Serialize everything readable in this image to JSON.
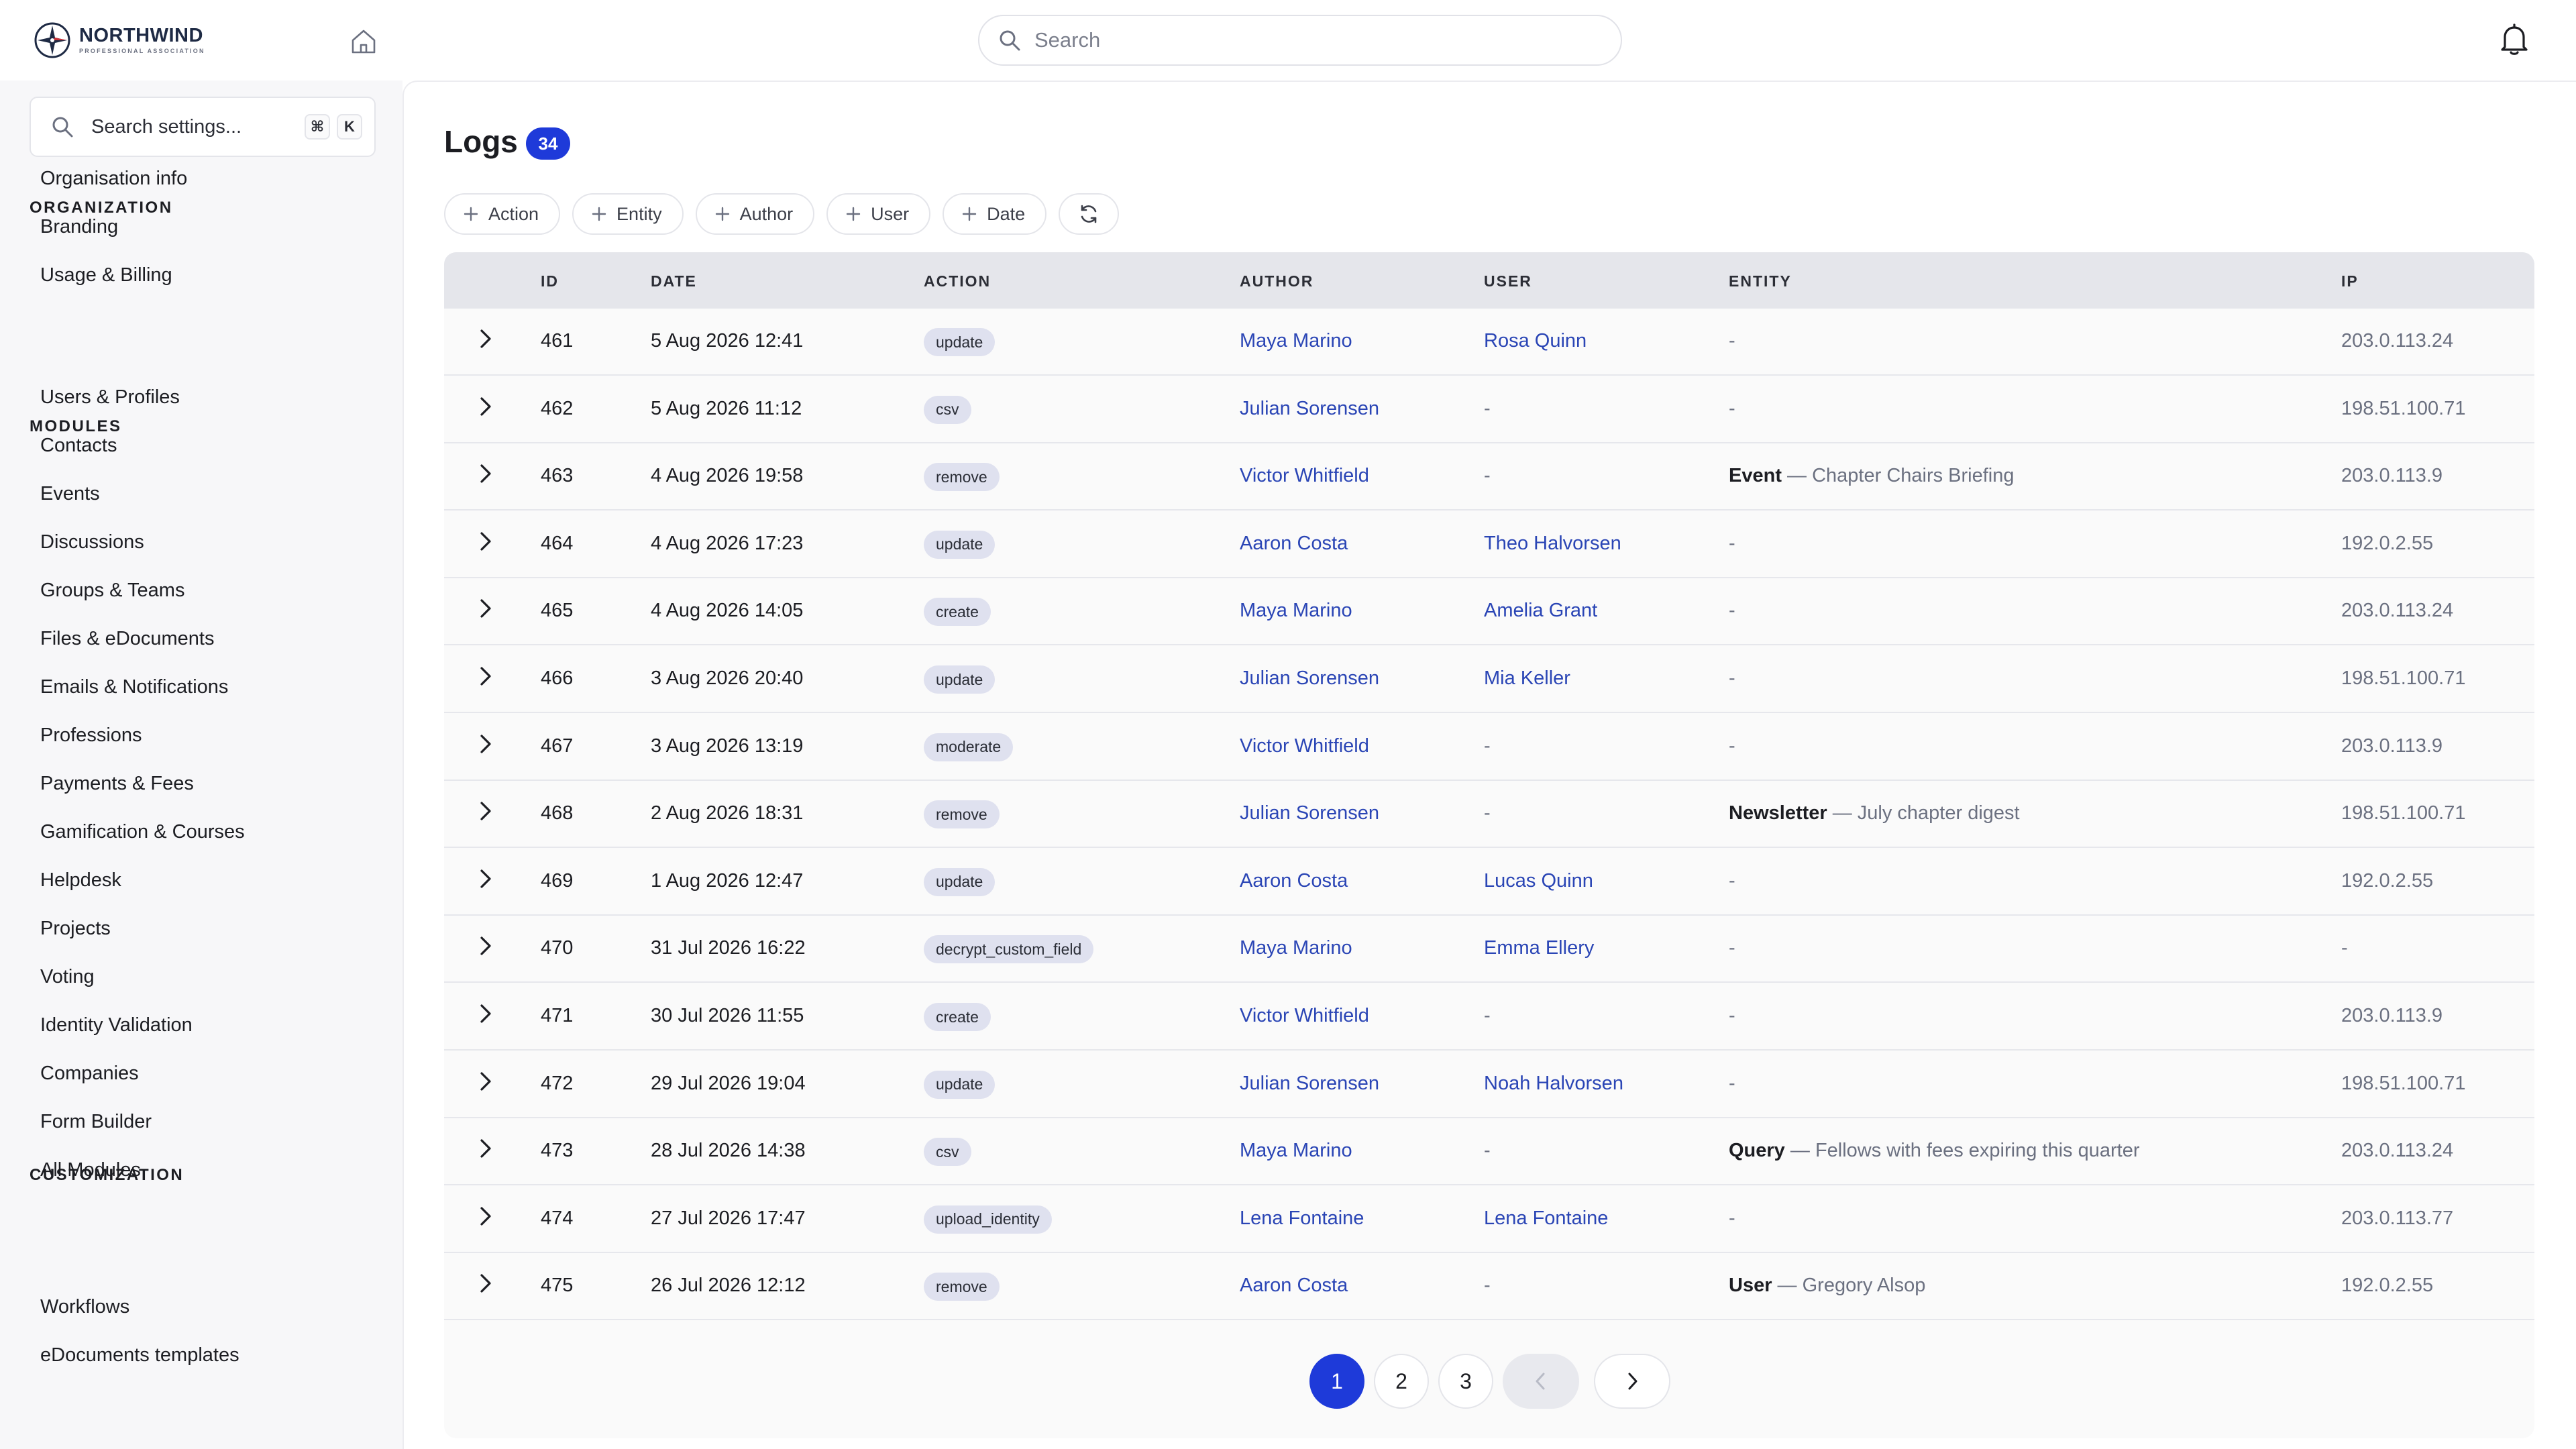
{
  "brand": {
    "name": "NORTHWIND",
    "tagline": "PROFESSIONAL ASSOCIATION",
    "accent": "#1e3ad9",
    "link": "#2a45b5"
  },
  "header": {
    "search_placeholder": "Search"
  },
  "sidebar": {
    "search_placeholder": "Search settings...",
    "shortcut": [
      "⌘",
      "K"
    ],
    "sections": [
      {
        "label": "ORGANIZATION",
        "items": [
          "Organisation info",
          "Branding",
          "Usage & Billing"
        ]
      },
      {
        "label": "MODULES",
        "items": [
          "Users & Profiles",
          "Contacts",
          "Events",
          "Discussions",
          "Groups & Teams",
          "Files & eDocuments",
          "Emails & Notifications",
          "Professions",
          "Payments & Fees",
          "Gamification & Courses",
          "Helpdesk",
          "Projects",
          "Voting",
          "Identity Validation",
          "Companies",
          "Form Builder",
          "All Modules"
        ]
      },
      {
        "label": "CUSTOMIZATION",
        "items": [
          "Workflows",
          "eDocuments templates"
        ]
      }
    ]
  },
  "main": {
    "title": "Logs",
    "count": "34",
    "filters": [
      "Action",
      "Entity",
      "Author",
      "User",
      "Date"
    ],
    "columns": [
      "ID",
      "DATE",
      "ACTION",
      "AUTHOR",
      "USER",
      "ENTITY",
      "IP"
    ],
    "rows": [
      {
        "id": "461",
        "date": "5 Aug 2026 12:41",
        "action": "update",
        "author": "Maya Marino",
        "user": "Rosa Quinn",
        "entity_type": "",
        "entity_name": "-",
        "ip": "203.0.113.24"
      },
      {
        "id": "462",
        "date": "5 Aug 2026 11:12",
        "action": "csv",
        "author": "Julian Sorensen",
        "user": "-",
        "entity_type": "",
        "entity_name": "-",
        "ip": "198.51.100.71"
      },
      {
        "id": "463",
        "date": "4 Aug 2026 19:58",
        "action": "remove",
        "author": "Victor Whitfield",
        "user": "-",
        "entity_type": "Event",
        "entity_name": " — Chapter Chairs Briefing",
        "ip": "203.0.113.9"
      },
      {
        "id": "464",
        "date": "4 Aug 2026 17:23",
        "action": "update",
        "author": "Aaron Costa",
        "user": "Theo Halvorsen",
        "entity_type": "",
        "entity_name": "-",
        "ip": "192.0.2.55"
      },
      {
        "id": "465",
        "date": "4 Aug 2026 14:05",
        "action": "create",
        "author": "Maya Marino",
        "user": "Amelia Grant",
        "entity_type": "",
        "entity_name": "-",
        "ip": "203.0.113.24"
      },
      {
        "id": "466",
        "date": "3 Aug 2026 20:40",
        "action": "update",
        "author": "Julian Sorensen",
        "user": "Mia Keller",
        "entity_type": "",
        "entity_name": "-",
        "ip": "198.51.100.71"
      },
      {
        "id": "467",
        "date": "3 Aug 2026 13:19",
        "action": "moderate",
        "author": "Victor Whitfield",
        "user": "-",
        "entity_type": "",
        "entity_name": "-",
        "ip": "203.0.113.9"
      },
      {
        "id": "468",
        "date": "2 Aug 2026 18:31",
        "action": "remove",
        "author": "Julian Sorensen",
        "user": "-",
        "entity_type": "Newsletter",
        "entity_name": " — July chapter digest",
        "ip": "198.51.100.71"
      },
      {
        "id": "469",
        "date": "1 Aug 2026 12:47",
        "action": "update",
        "author": "Aaron Costa",
        "user": "Lucas Quinn",
        "entity_type": "",
        "entity_name": "-",
        "ip": "192.0.2.55"
      },
      {
        "id": "470",
        "date": "31 Jul 2026 16:22",
        "action": "decrypt_custom_field",
        "author": "Maya Marino",
        "user": "Emma Ellery",
        "entity_type": "",
        "entity_name": "-",
        "ip": "-"
      },
      {
        "id": "471",
        "date": "30 Jul 2026 11:55",
        "action": "create",
        "author": "Victor Whitfield",
        "user": "-",
        "entity_type": "",
        "entity_name": "-",
        "ip": "203.0.113.9"
      },
      {
        "id": "472",
        "date": "29 Jul 2026 19:04",
        "action": "update",
        "author": "Julian Sorensen",
        "user": "Noah Halvorsen",
        "entity_type": "",
        "entity_name": "-",
        "ip": "198.51.100.71"
      },
      {
        "id": "473",
        "date": "28 Jul 2026 14:38",
        "action": "csv",
        "author": "Maya Marino",
        "user": "-",
        "entity_type": "Query",
        "entity_name": " — Fellows with fees expiring this quarter",
        "ip": "203.0.113.24"
      },
      {
        "id": "474",
        "date": "27 Jul 2026 17:47",
        "action": "upload_identity",
        "author": "Lena Fontaine",
        "user": "Lena Fontaine",
        "entity_type": "",
        "entity_name": "-",
        "ip": "203.0.113.77"
      },
      {
        "id": "475",
        "date": "26 Jul 2026 12:12",
        "action": "remove",
        "author": "Aaron Costa",
        "user": "-",
        "entity_type": "User",
        "entity_name": " — Gregory Alsop",
        "ip": "192.0.2.55"
      }
    ],
    "pagination": {
      "pages": [
        "1",
        "2",
        "3"
      ],
      "current": "1"
    }
  }
}
